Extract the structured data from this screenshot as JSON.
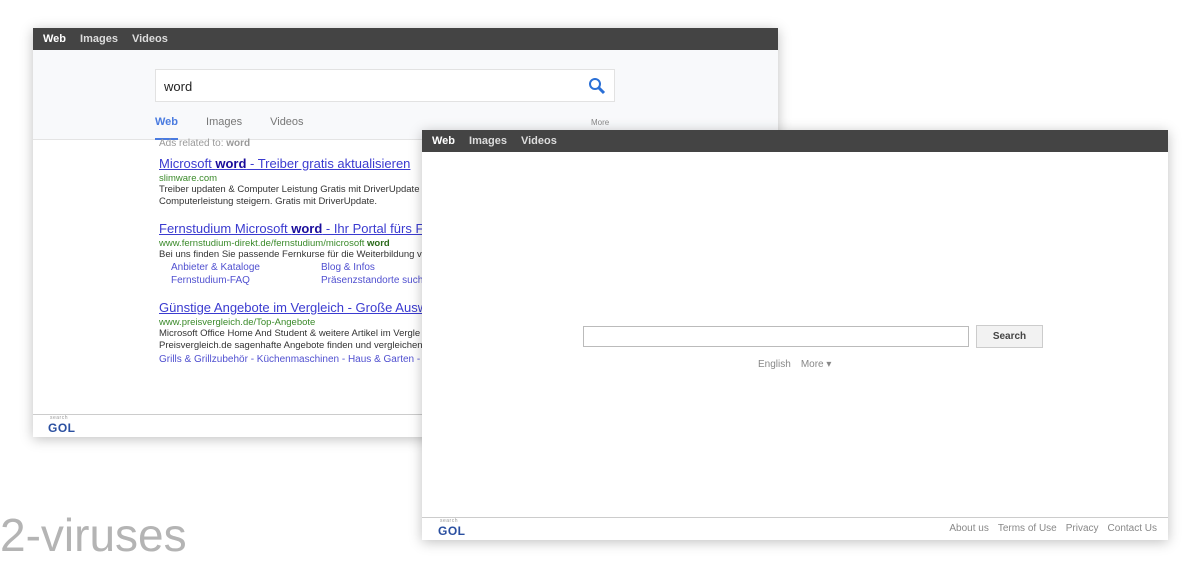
{
  "left_window": {
    "nav": [
      "Web",
      "Images",
      "Videos"
    ],
    "search_value": "word",
    "tabs": [
      "Web",
      "Images",
      "Videos"
    ],
    "more": "More",
    "ads_label": "Ads related to:",
    "ads_query": "word",
    "results": [
      {
        "title_pre": "Microsoft ",
        "title_bold": "word",
        "title_post": " - Treiber gratis aktualisieren",
        "url_pre": "slimware.com",
        "url_bold": "",
        "desc": [
          "Treiber updaten & Computer Leistung Gratis mit DriverUpdate",
          "Computerleistung steigern. Gratis mit DriverUpdate."
        ]
      },
      {
        "title_pre": "Fernstudium Microsoft ",
        "title_bold": "word",
        "title_post": " - Ihr Portal fürs Fe",
        "url_pre": "www.fernstudium-direkt.de/fernstudium/microsoft ",
        "url_bold": "word",
        "desc": [
          "Bei uns finden Sie passende Fernkurse für die Weiterbildung v"
        ],
        "sitelinks": [
          "Anbieter & Kataloge",
          "Blog & Infos",
          "Fernstudium-FAQ",
          "Präsenzstandorte suche"
        ]
      },
      {
        "title_pre": "Günstige Angebote im Vergleich - Große Ausw",
        "title_bold": "",
        "title_post": "",
        "url_pre": "www.preisvergleich.de/Top-Angebote",
        "url_bold": "",
        "desc": [
          "Microsoft Office Home And Student & weitere Artikel im Vergle",
          "Preisvergleich.de sagenhafte Angebote finden und vergleichen"
        ],
        "bottom_links": "Grills & Grillzubehör - Küchenmaschinen - Haus & Garten -"
      }
    ],
    "logo": "GOL",
    "logo_small": "search"
  },
  "right_window": {
    "nav": [
      "Web",
      "Images",
      "Videos"
    ],
    "search_value": "",
    "search_button": "Search",
    "language": "English",
    "more": "More ▾",
    "footer_links": [
      "About us",
      "Terms of Use",
      "Privacy",
      "Contact Us"
    ],
    "logo": "GOL",
    "logo_small": "search"
  },
  "watermark": "2-viruses",
  "colors": {
    "topbar": "#444444",
    "tab_active": "#4a7be0",
    "link": "#3b3bd0",
    "url": "#3a8a2a"
  }
}
